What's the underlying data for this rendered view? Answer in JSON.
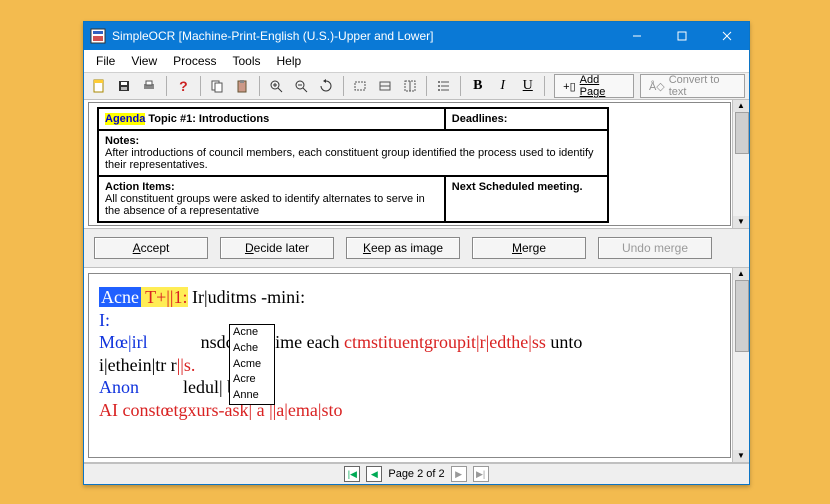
{
  "window": {
    "title": "SimpleOCR [Machine-Print-English (U.S.)-Upper and Lower]"
  },
  "menu": {
    "file": "File",
    "view": "View",
    "process": "Process",
    "tools": "Tools",
    "help": "Help"
  },
  "toolbar": {
    "bold_label": "B",
    "italic_label": "I",
    "underline_label": "U",
    "add_page_label": "Add Page",
    "convert_label": "Convert to text"
  },
  "preview": {
    "agenda_label": "Agenda",
    "agenda_topic": " Topic #1: Introductions",
    "deadlines_label": "Deadlines:",
    "notes_label": "Notes:",
    "notes_body": "After introductions of council members, each constituent group identified the process used to identify their representatives.",
    "action_items_label": "Action Items:",
    "action_items_body": "All constituent groups were asked to identify alternates to serve in the absence of a representative",
    "next_label": "Next Scheduled meeting."
  },
  "buttons": {
    "accept": "Accept",
    "decide": "Decide later",
    "keep": "Keep as image",
    "merge": "Merge",
    "undo": "Undo merge"
  },
  "result": {
    "selected": "Acne",
    "line1_red": " T+||1:",
    "line1_rest": " Ir|uditms -mini:",
    "line2": "I:",
    "line3_a": "Mœ|irl",
    "line3_b": "nsdcxrril rime each ",
    "line3_c": "ctmstituentgroupit|r|edthe|ss",
    "line3_d": " unto",
    "line4_a": "i|ethein|tr r",
    "line4_b": "||s.",
    "line5_a": "Anon",
    "line5_b": "ledul| by.",
    "line6_a": "AI constœtgxurs-ask| a ",
    "line6_b": "||a|ema|sto",
    "suggestions": [
      "Acne",
      "Ache",
      "Acme",
      "Acre",
      "Anne"
    ]
  },
  "pagebar": {
    "label": "Page 2 of 2"
  }
}
